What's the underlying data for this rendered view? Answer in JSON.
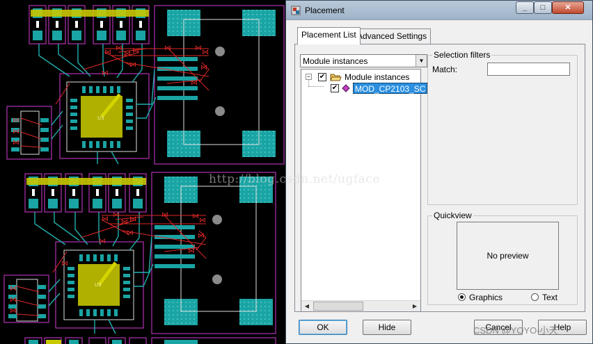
{
  "dialog": {
    "title": "Placement",
    "controls": {
      "minimize": "_",
      "maximize": "□",
      "close": "✕"
    },
    "tabs": [
      {
        "label": "Placement List",
        "active": true
      },
      {
        "label": "Advanced Settings",
        "active": false
      }
    ],
    "dropdown": {
      "selected": "Module instances"
    },
    "tree": {
      "root": {
        "label": "Module instances",
        "expander": "−",
        "checked": true,
        "icon": "open-folder-icon"
      },
      "children": [
        {
          "label": "MOD_CP2103_SC",
          "checked": true,
          "selected": true,
          "icon": "module-diamond-icon"
        }
      ]
    },
    "selection_filters": {
      "title": "Selection filters",
      "match_label": "Match:",
      "match_value": ""
    },
    "quickview": {
      "title": "Quickview",
      "preview_text": "No preview",
      "radio_graphics": "Graphics",
      "radio_text": "Text",
      "selected": "Graphics"
    },
    "buttons": {
      "ok": "OK",
      "hide": "Hide",
      "cancel": "Cancel",
      "help": "Help"
    }
  },
  "pcb": {
    "footprint_label_1": "U3",
    "footprint_label_2": "U3"
  },
  "watermarks": {
    "url": "http://blog.csdn.net/ugface",
    "credit": "CSDN @YOYO-小天"
  },
  "colors": {
    "pad": "#1aa4a4",
    "outline": "#d63bd6",
    "ratsnest": "#e02828",
    "trace": "#20b0b0",
    "silk": "#c8c800",
    "highlight": "#2a8fe0"
  }
}
